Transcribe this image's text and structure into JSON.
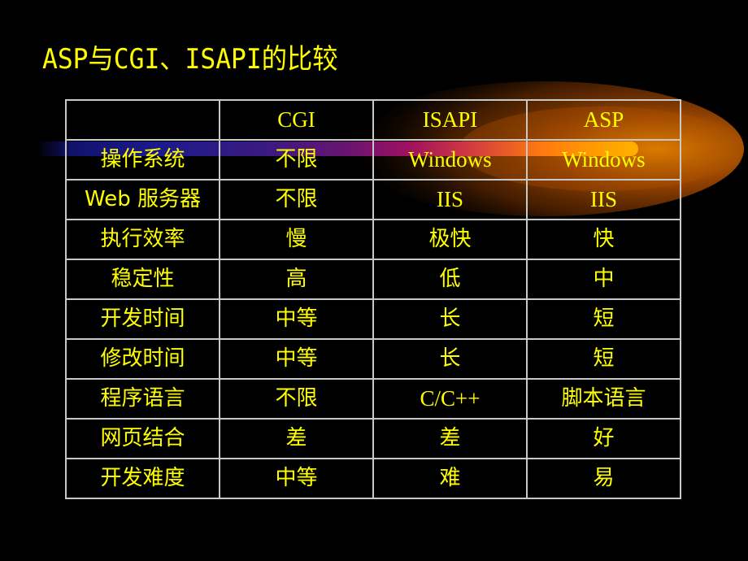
{
  "slide": {
    "title": "ASP与CGI、ISAPI的比较",
    "colors": {
      "background": "#000000",
      "text": "#ffff00",
      "grid": "#c8c8c8",
      "accent_comet": "#ff8c00"
    }
  },
  "table": {
    "corner": "",
    "columns": [
      "CGI",
      "ISAPI",
      "ASP"
    ],
    "rows": [
      {
        "label": "操作系统",
        "values": [
          "不限",
          "Windows",
          "Windows"
        ]
      },
      {
        "label": "Web 服务器",
        "values": [
          "不限",
          "IIS",
          "IIS"
        ]
      },
      {
        "label": "执行效率",
        "values": [
          "慢",
          "极快",
          "快"
        ]
      },
      {
        "label": "稳定性",
        "values": [
          "高",
          "低",
          "中"
        ]
      },
      {
        "label": "开发时间",
        "values": [
          "中等",
          "长",
          "短"
        ]
      },
      {
        "label": "修改时间",
        "values": [
          "中等",
          "长",
          "短"
        ]
      },
      {
        "label": "程序语言",
        "values": [
          "不限",
          "C/C++",
          "脚本语言"
        ]
      },
      {
        "label": "网页结合",
        "values": [
          "差",
          "差",
          "好"
        ]
      },
      {
        "label": "开发难度",
        "values": [
          "中等",
          "难",
          "易"
        ]
      }
    ]
  }
}
